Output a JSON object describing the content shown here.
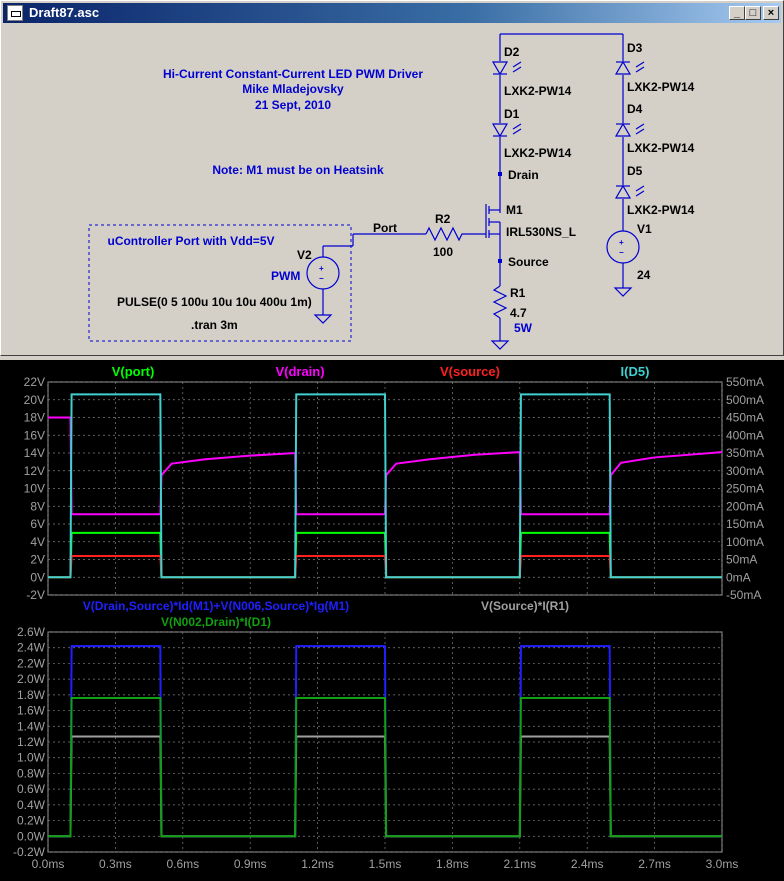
{
  "window": {
    "title": "Draft87.asc",
    "buttons": [
      "_",
      "□",
      "×"
    ]
  },
  "schematic": {
    "header": [
      "Hi-Current Constant-Current LED PWM Driver",
      "Mike Mladejovsky",
      "21 Sept, 2010"
    ],
    "note": "Note: M1 must be on Heatsink",
    "port_box_label": "uController Port with Vdd=5V",
    "net_port": "Port",
    "net_drain": "Drain",
    "net_source": "Source",
    "components": {
      "D2": {
        "ref": "D2",
        "value": "LXK2-PW14"
      },
      "D1": {
        "ref": "D1",
        "value": "LXK2-PW14"
      },
      "D3": {
        "ref": "D3",
        "value": "LXK2-PW14"
      },
      "D4": {
        "ref": "D4",
        "value": "LXK2-PW14"
      },
      "D5": {
        "ref": "D5",
        "value": "LXK2-PW14"
      },
      "M1": {
        "ref": "M1",
        "value": "IRL530NS_L"
      },
      "R2": {
        "ref": "R2",
        "value": "100"
      },
      "R1": {
        "ref": "R1",
        "value": "4.7",
        "extra": "5W"
      },
      "V1": {
        "ref": "V1",
        "value": "24"
      },
      "V2": {
        "ref": "V2",
        "value": "PWM"
      }
    },
    "pulse_directive": "PULSE(0 5 100u 10u 10u 400u 1m)",
    "tran_directive": ".tran 3m"
  },
  "colors": {
    "port": "#00ff00",
    "drain": "#ff00ff",
    "source": "#ff2020",
    "d5": "#40d0d0",
    "pm1": "#2020ff",
    "pr1": "#a0a0a0",
    "pd1": "#10a010",
    "grid": "#808080",
    "axis": "#a0a0a0"
  },
  "chart_data": [
    {
      "type": "line",
      "x_label": "",
      "xlim": [
        0,
        3.0
      ],
      "ylim_left": [
        -2,
        22
      ],
      "ylim_right": [
        -50,
        550
      ],
      "left_ticks": [
        "22V",
        "20V",
        "18V",
        "16V",
        "14V",
        "12V",
        "10V",
        "8V",
        "6V",
        "4V",
        "2V",
        "0V",
        "-2V"
      ],
      "right_ticks": [
        "550mA",
        "500mA",
        "450mA",
        "400mA",
        "350mA",
        "300mA",
        "250mA",
        "200mA",
        "150mA",
        "100mA",
        "50mA",
        "0mA",
        "-50mA"
      ],
      "series": [
        {
          "name": "V(port)",
          "axis": "left",
          "x": [
            0,
            0.1,
            0.105,
            0.5,
            0.505,
            1.1,
            1.105,
            1.5,
            1.505,
            2.1,
            2.105,
            2.5,
            2.505,
            3.0
          ],
          "y": [
            0,
            0,
            5,
            5,
            0,
            0,
            5,
            5,
            0,
            0,
            5,
            5,
            0,
            0
          ]
        },
        {
          "name": "V(drain)",
          "axis": "left",
          "x": [
            0,
            0.1,
            0.105,
            0.5,
            0.505,
            0.55,
            0.7,
            0.9,
            1.1,
            1.105,
            1.5,
            1.505,
            1.55,
            1.7,
            1.9,
            2.1,
            2.105,
            2.5,
            2.505,
            2.55,
            2.7,
            3.0
          ],
          "y": [
            18,
            18,
            7.1,
            7.1,
            11.5,
            12.8,
            13.3,
            13.7,
            14,
            7.1,
            7.1,
            11.5,
            12.8,
            13.3,
            13.8,
            14.1,
            7.1,
            7.1,
            11.5,
            12.9,
            13.5,
            14.1
          ]
        },
        {
          "name": "V(source)",
          "axis": "left",
          "x": [
            0,
            0.1,
            0.105,
            0.5,
            0.505,
            1.1,
            1.105,
            1.5,
            1.505,
            2.1,
            2.105,
            2.5,
            2.505,
            3.0
          ],
          "y": [
            0,
            0,
            2.4,
            2.4,
            0,
            0,
            2.4,
            2.4,
            0,
            0,
            2.4,
            2.4,
            0,
            0
          ]
        },
        {
          "name": "I(D5)",
          "axis": "right",
          "x": [
            0,
            0.1,
            0.105,
            0.5,
            0.505,
            1.1,
            1.105,
            1.5,
            1.505,
            2.1,
            2.105,
            2.5,
            2.505,
            3.0
          ],
          "y": [
            0,
            0,
            515,
            515,
            0,
            0,
            515,
            515,
            0,
            0,
            515,
            515,
            0,
            0
          ]
        }
      ]
    },
    {
      "type": "line",
      "xlim": [
        0,
        3.0
      ],
      "ylim": [
        -0.2,
        2.6
      ],
      "y_ticks": [
        "2.6W",
        "2.4W",
        "2.2W",
        "2.0W",
        "1.8W",
        "1.6W",
        "1.4W",
        "1.2W",
        "1.0W",
        "0.8W",
        "0.6W",
        "0.4W",
        "0.2W",
        "0.0W",
        "-0.2W"
      ],
      "x_ticks": [
        "0.0ms",
        "0.3ms",
        "0.6ms",
        "0.9ms",
        "1.2ms",
        "1.5ms",
        "1.8ms",
        "2.1ms",
        "2.4ms",
        "2.7ms",
        "3.0ms"
      ],
      "series": [
        {
          "name": "V(Drain,Source)*Id(M1)+V(N006,Source)*Ig(M1)",
          "x": [
            0,
            0.1,
            0.105,
            0.5,
            0.505,
            1.1,
            1.105,
            1.5,
            1.505,
            2.1,
            2.105,
            2.5,
            2.505,
            3.0
          ],
          "y": [
            0,
            0,
            2.42,
            2.42,
            0,
            0,
            2.42,
            2.42,
            0,
            0,
            2.42,
            2.42,
            0,
            0
          ]
        },
        {
          "name": "V(Source)*I(R1)",
          "x": [
            0,
            0.1,
            0.105,
            0.5,
            0.505,
            1.1,
            1.105,
            1.5,
            1.505,
            2.1,
            2.105,
            2.5,
            2.505,
            3.0
          ],
          "y": [
            0,
            0,
            1.27,
            1.27,
            0,
            0,
            1.27,
            1.27,
            0,
            0,
            1.27,
            1.27,
            0,
            0
          ]
        },
        {
          "name": "V(N002,Drain)*I(D1)",
          "x": [
            0,
            0.1,
            0.105,
            0.5,
            0.505,
            1.1,
            1.105,
            1.5,
            1.505,
            2.1,
            2.105,
            2.5,
            2.505,
            3.0
          ],
          "y": [
            0,
            0,
            1.76,
            1.76,
            0,
            0,
            1.76,
            1.76,
            0,
            0,
            1.76,
            1.76,
            0,
            0
          ]
        }
      ]
    }
  ]
}
